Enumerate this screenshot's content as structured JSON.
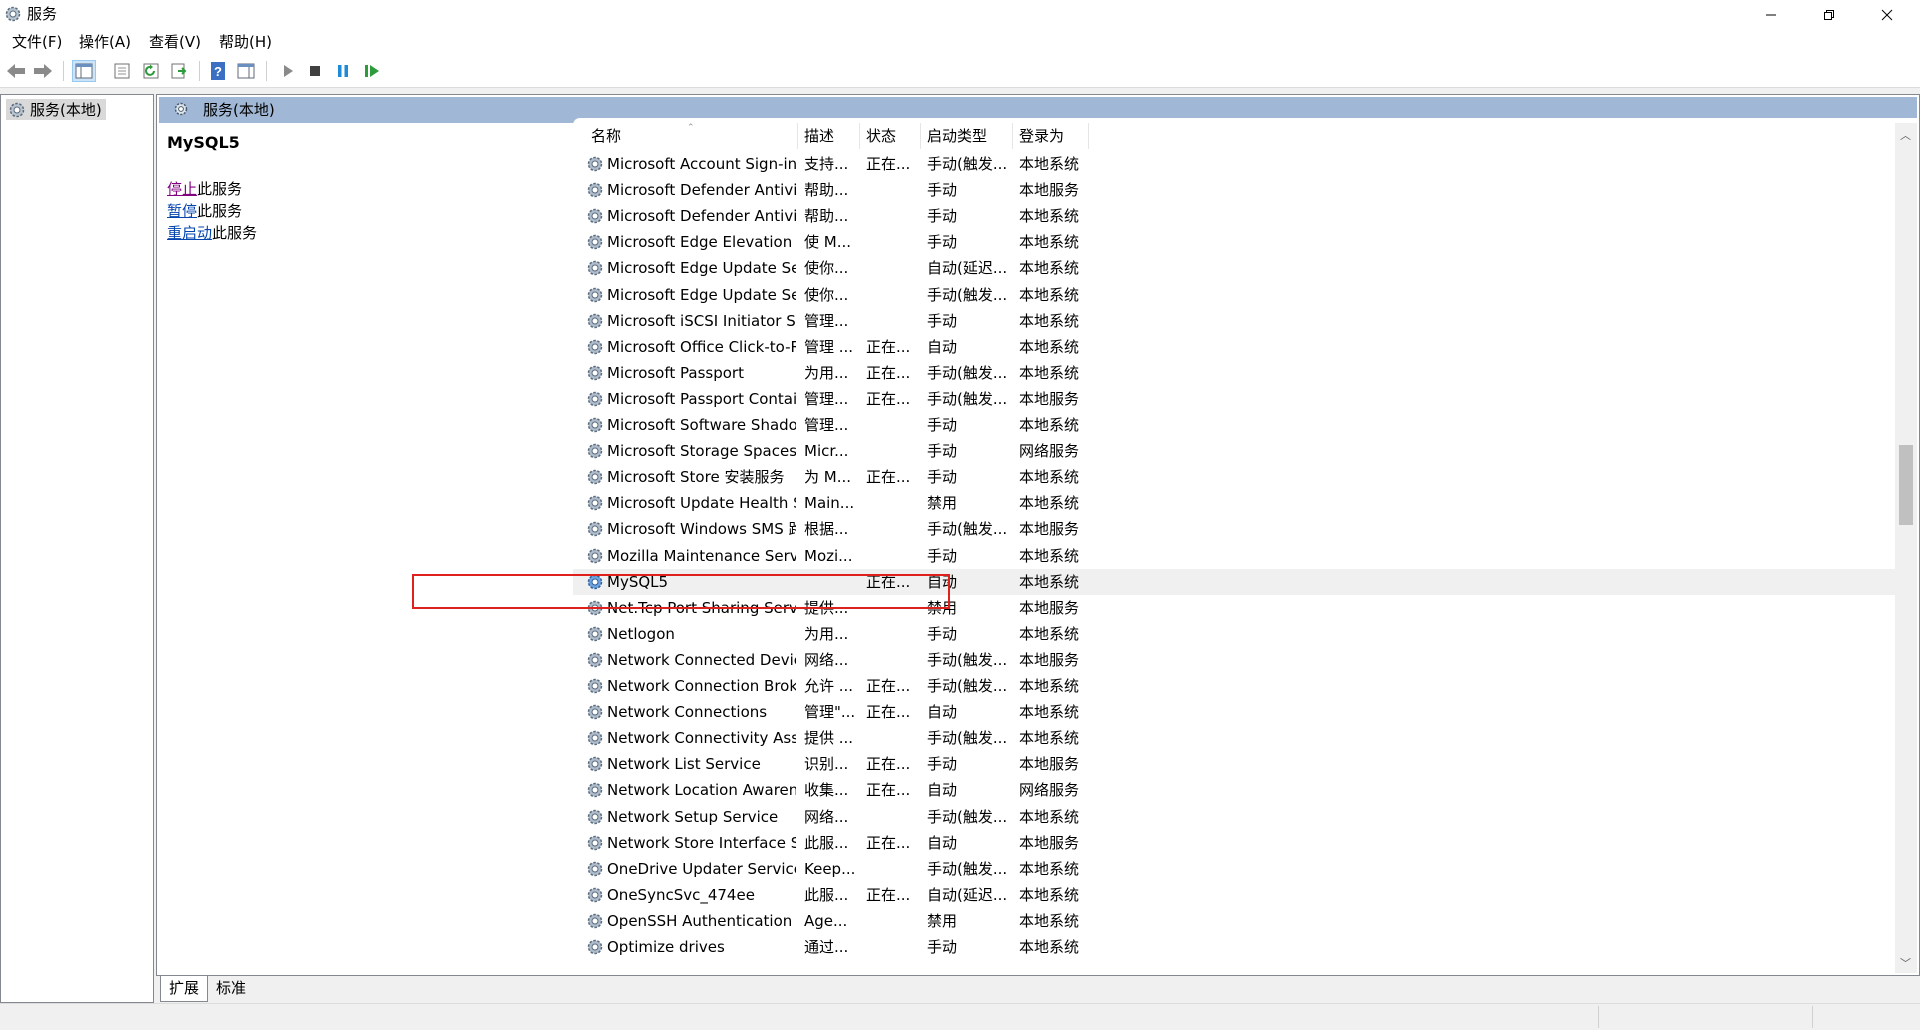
{
  "window": {
    "title": "服务",
    "controls": [
      "minimize",
      "restore",
      "close"
    ]
  },
  "menu": [
    "文件(F)",
    "操作(A)",
    "查看(V)",
    "帮助(H)"
  ],
  "toolbar": {
    "buttons": [
      "back-icon",
      "forward-icon",
      "console-tree-icon",
      "properties-icon",
      "refresh-icon",
      "export-icon",
      "help-icon",
      "action-pane-icon",
      "start-icon",
      "stop-icon",
      "pause-icon",
      "restart-icon"
    ]
  },
  "tree": {
    "root": "服务(本地)"
  },
  "banner": {
    "title": "服务(本地)"
  },
  "details": {
    "service_name": "MySQL5",
    "actions": [
      {
        "link": "停止",
        "text": "此服务"
      },
      {
        "link": "暂停",
        "text": "此服务"
      },
      {
        "link": "重启动",
        "text": "此服务"
      }
    ]
  },
  "columns": {
    "name": "名称",
    "desc": "描述",
    "status": "状态",
    "startup": "启动类型",
    "logon": "登录为"
  },
  "rows": [
    {
      "name": "Microsoft Account Sign-in ...",
      "desc": "支持...",
      "status": "正在...",
      "startup": "手动(触发...",
      "logon": "本地系统"
    },
    {
      "name": "Microsoft Defender Antivir...",
      "desc": "帮助...",
      "status": "",
      "startup": "手动",
      "logon": "本地服务"
    },
    {
      "name": "Microsoft Defender Antivir...",
      "desc": "帮助...",
      "status": "",
      "startup": "手动",
      "logon": "本地系统"
    },
    {
      "name": "Microsoft Edge Elevation S...",
      "desc": "使 M...",
      "status": "",
      "startup": "手动",
      "logon": "本地系统"
    },
    {
      "name": "Microsoft Edge Update Ser...",
      "desc": "使你...",
      "status": "",
      "startup": "自动(延迟...",
      "logon": "本地系统"
    },
    {
      "name": "Microsoft Edge Update Ser...",
      "desc": "使你...",
      "status": "",
      "startup": "手动(触发...",
      "logon": "本地系统"
    },
    {
      "name": "Microsoft iSCSI Initiator Ser...",
      "desc": "管理...",
      "status": "",
      "startup": "手动",
      "logon": "本地系统"
    },
    {
      "name": "Microsoft Office Click-to-R...",
      "desc": "管理 ...",
      "status": "正在...",
      "startup": "自动",
      "logon": "本地系统"
    },
    {
      "name": "Microsoft Passport",
      "desc": "为用...",
      "status": "正在...",
      "startup": "手动(触发...",
      "logon": "本地系统"
    },
    {
      "name": "Microsoft Passport Container",
      "desc": "管理...",
      "status": "正在...",
      "startup": "手动(触发...",
      "logon": "本地服务"
    },
    {
      "name": "Microsoft Software Shado...",
      "desc": "管理...",
      "status": "",
      "startup": "手动",
      "logon": "本地系统"
    },
    {
      "name": "Microsoft Storage Spaces S...",
      "desc": "Micr...",
      "status": "",
      "startup": "手动",
      "logon": "网络服务"
    },
    {
      "name": "Microsoft Store 安装服务",
      "desc": "为 M...",
      "status": "正在...",
      "startup": "手动",
      "logon": "本地系统"
    },
    {
      "name": "Microsoft Update Health S...",
      "desc": "Main...",
      "status": "",
      "startup": "禁用",
      "logon": "本地系统"
    },
    {
      "name": "Microsoft Windows SMS 路...",
      "desc": "根据...",
      "status": "",
      "startup": "手动(触发...",
      "logon": "本地服务"
    },
    {
      "name": "Mozilla Maintenance Service",
      "desc": "Mozi...",
      "status": "",
      "startup": "手动",
      "logon": "本地系统"
    },
    {
      "name": "MySQL5",
      "desc": "",
      "status": "正在...",
      "startup": "自动",
      "logon": "本地系统",
      "selected": true
    },
    {
      "name": "Net.Tcp Port Sharing Service",
      "desc": "提供...",
      "status": "",
      "startup": "禁用",
      "logon": "本地服务"
    },
    {
      "name": "Netlogon",
      "desc": "为用...",
      "status": "",
      "startup": "手动",
      "logon": "本地系统"
    },
    {
      "name": "Network Connected Devic...",
      "desc": "网络...",
      "status": "",
      "startup": "手动(触发...",
      "logon": "本地服务"
    },
    {
      "name": "Network Connection Broker",
      "desc": "允许 ...",
      "status": "正在...",
      "startup": "手动(触发...",
      "logon": "本地系统"
    },
    {
      "name": "Network Connections",
      "desc": "管理\"...",
      "status": "正在...",
      "startup": "自动",
      "logon": "本地系统"
    },
    {
      "name": "Network Connectivity Assis...",
      "desc": "提供 ...",
      "status": "",
      "startup": "手动(触发...",
      "logon": "本地系统"
    },
    {
      "name": "Network List Service",
      "desc": "识别...",
      "status": "正在...",
      "startup": "手动",
      "logon": "本地服务"
    },
    {
      "name": "Network Location Awarene...",
      "desc": "收集...",
      "status": "正在...",
      "startup": "自动",
      "logon": "网络服务"
    },
    {
      "name": "Network Setup Service",
      "desc": "网络...",
      "status": "",
      "startup": "手动(触发...",
      "logon": "本地系统"
    },
    {
      "name": "Network Store Interface Se...",
      "desc": "此服...",
      "status": "正在...",
      "startup": "自动",
      "logon": "本地服务"
    },
    {
      "name": "OneDrive Updater Service",
      "desc": "Keep...",
      "status": "",
      "startup": "手动(触发...",
      "logon": "本地系统"
    },
    {
      "name": "OneSyncSvc_474ee",
      "desc": "此服...",
      "status": "正在...",
      "startup": "自动(延迟...",
      "logon": "本地系统"
    },
    {
      "name": "OpenSSH Authentication ...",
      "desc": "Age...",
      "status": "",
      "startup": "禁用",
      "logon": "本地系统"
    },
    {
      "name": "Optimize drives",
      "desc": "通过...",
      "status": "",
      "startup": "手动",
      "logon": "本地系统"
    }
  ],
  "tabs": [
    "扩展",
    "标准"
  ],
  "colors": {
    "banner": "#a0b8d6",
    "highlight": "#e0201c",
    "link_visited": "#800080",
    "link": "#0645ad"
  }
}
